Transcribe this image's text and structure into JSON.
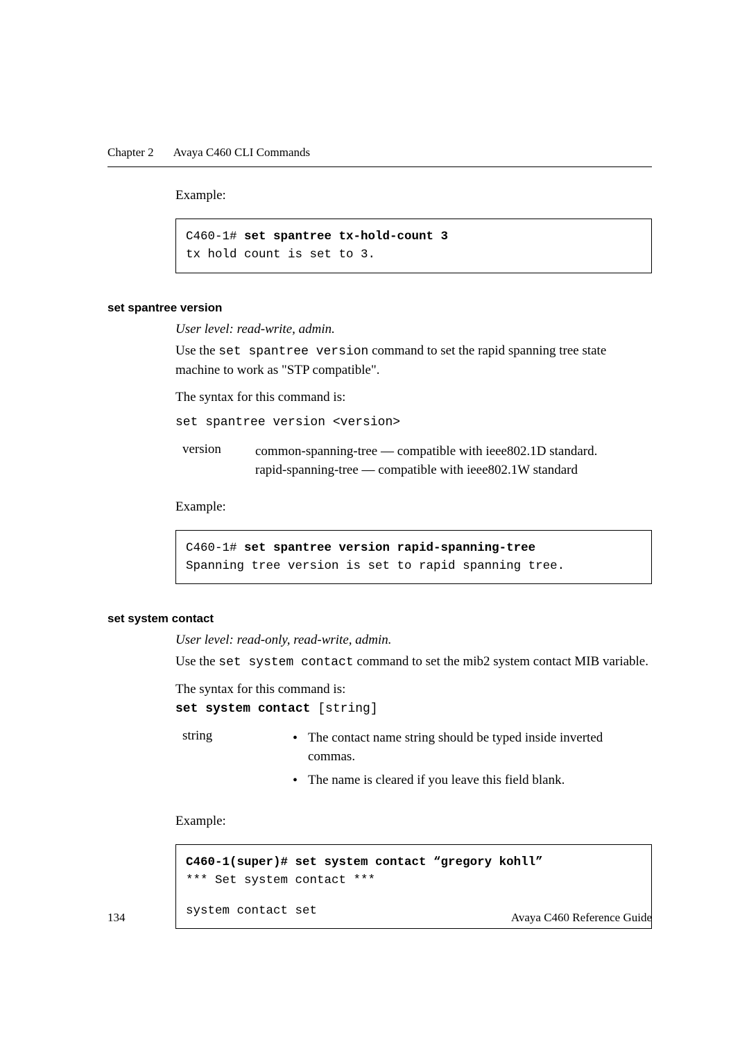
{
  "header": {
    "chapter": "Chapter 2",
    "title": "Avaya C460 CLI Commands"
  },
  "sec1": {
    "example_label": "Example:",
    "code_prompt": "C460-1# ",
    "code_cmd": "set spantree tx-hold-count 3",
    "code_output": "tx hold count is set to 3."
  },
  "sec2": {
    "heading": "set spantree version",
    "user_level": "User level: read-write, admin.",
    "desc_prefix": "Use the ",
    "desc_code": "set spantree version",
    "desc_suffix": " command to set the rapid spanning tree state machine to work as \"STP compatible\".",
    "syntax_intro": "The syntax for this command is:",
    "syntax_line": "set spantree version <version>",
    "param_name": "version",
    "param_desc1": "common-spanning-tree — compatible with ieee802.1D standard.",
    "param_desc2": "rapid-spanning-tree — compatible with ieee802.1W standard",
    "example_label": "Example:",
    "code_prompt": "C460-1# ",
    "code_cmd": "set spantree version rapid-spanning-tree",
    "code_output": "Spanning tree version is set to rapid spanning tree."
  },
  "sec3": {
    "heading": "set system contact",
    "user_level": "User level: read-only, read-write, admin.",
    "desc_prefix": "Use the ",
    "desc_code": "set system contact",
    "desc_suffix": " command to set the mib2 system contact MIB variable.",
    "syntax_intro": "The syntax for this command is:",
    "syntax_bold": "set system contact",
    "syntax_arg": " [string]",
    "param_name": "string",
    "bullet1": "The contact name string should be typed inside inverted commas.",
    "bullet2": "The name is cleared if you leave this field blank.",
    "example_label": "Example:",
    "code_prompt": "C460-1(super)# set system contact “gregory kohll”",
    "code_output1": "*** Set system contact ***",
    "code_output2": "system contact set"
  },
  "footer": {
    "page": "134",
    "doc": "Avaya C460 Reference Guide"
  }
}
